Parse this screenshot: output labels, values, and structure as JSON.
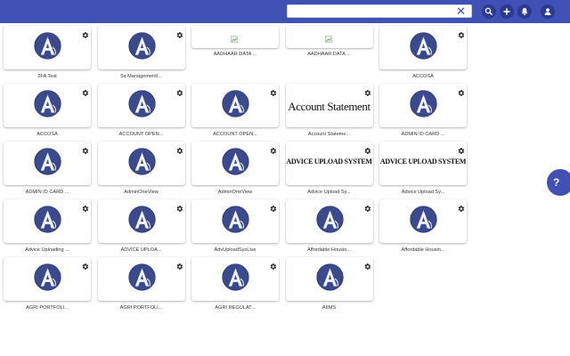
{
  "search": {
    "value": "",
    "placeholder": ""
  },
  "toolbar": {
    "search_icon": "search-icon",
    "add_icon": "plus-icon",
    "notif_icon": "bell-icon",
    "account_icon": "account-icon"
  },
  "fab": {
    "icon": "help-icon",
    "label": "?"
  },
  "colors": {
    "primary": "#3f51b5",
    "logo_fill": "#3b4a8c"
  },
  "tiles": [
    {
      "label": "2FA Test",
      "img": "logo"
    },
    {
      "label": "5a Managementl...",
      "img": "logo"
    },
    {
      "label": "AADHAAR DATA ...",
      "img": "broken"
    },
    {
      "label": "AADHAAR DATA ...",
      "img": "broken"
    },
    {
      "label": "ACCOSA",
      "img": "logo"
    },
    {
      "label": "ACCOSA",
      "img": "logo"
    },
    {
      "label": "ACCOUNT OPEN...",
      "img": "logo"
    },
    {
      "label": "ACCOUNT OPEN...",
      "img": "logo"
    },
    {
      "label": "Account Stateme...",
      "img": "text",
      "img_text": "Account Statement",
      "style": "acct"
    },
    {
      "label": "ADMIN ID CARD ...",
      "img": "logo"
    },
    {
      "label": "ADMIN ID CARD ...",
      "img": "logo"
    },
    {
      "label": "AdminOneView",
      "img": "logo"
    },
    {
      "label": "AdminOneView",
      "img": "logo"
    },
    {
      "label": "Advice Upload Sy...",
      "img": "text",
      "img_text": "ADVICE UPLOAD SYSTEM",
      "style": "adv"
    },
    {
      "label": "Advice Upload Sy...",
      "img": "text",
      "img_text": "ADVICE UPLOAD SYSTEM",
      "style": "adv"
    },
    {
      "label": "Advice Uploading ...",
      "img": "logo"
    },
    {
      "label": "ADVICE UPLOA...",
      "img": "logo"
    },
    {
      "label": "AdvUploadSysLive",
      "img": "logo"
    },
    {
      "label": "Affordable Housin...",
      "img": "logo"
    },
    {
      "label": "Affordable Housin...",
      "img": "logo"
    },
    {
      "label": "AGRI PORTFOLI...",
      "img": "logo"
    },
    {
      "label": "AGRI PORTFOLI...",
      "img": "logo"
    },
    {
      "label": "AGRI REGULAT...",
      "img": "logo"
    },
    {
      "label": "AIIMS",
      "img": "logo"
    }
  ]
}
